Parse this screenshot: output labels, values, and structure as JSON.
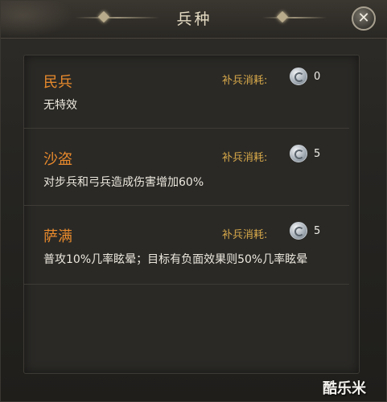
{
  "window": {
    "title": "兵种"
  },
  "units": [
    {
      "name": "民兵",
      "cost_label": "补兵消耗:",
      "cost": "0",
      "description": "无特效"
    },
    {
      "name": "沙盗",
      "cost_label": "补兵消耗:",
      "cost": "5",
      "description": "对步兵和弓兵造成伤害增加60%"
    },
    {
      "name": "萨满",
      "cost_label": "补兵消耗:",
      "cost": "5",
      "description": "普攻10%几率眩晕；目标有负面效果则50%几率眩晕"
    }
  ],
  "colors": {
    "unit_name": "#e88a2c",
    "cost_label": "#d8a94a",
    "text": "#ece8de"
  },
  "watermark": "酷乐米"
}
